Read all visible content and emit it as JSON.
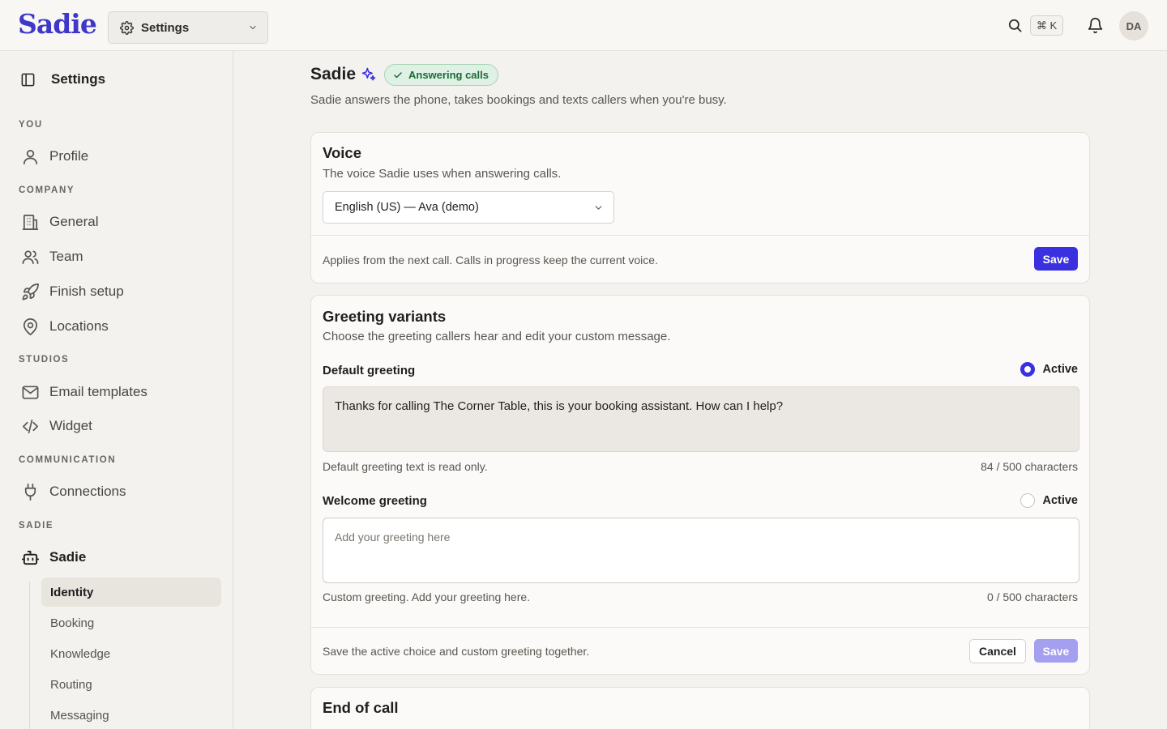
{
  "brand": {
    "logo": "Sadie",
    "accent": "#3b30e0"
  },
  "topbar": {
    "workspace_select": "Settings",
    "shortcut": "⌘ K",
    "avatar_initials": "DA"
  },
  "sidebar": {
    "title": "Settings",
    "sections": {
      "you": "YOU",
      "company": "COMPANY",
      "studios": "STUDIOS",
      "communication": "COMMUNICATION",
      "sadie": "SADIE"
    },
    "items": {
      "profile": "Profile",
      "general": "General",
      "team": "Team",
      "finish_setup": "Finish setup",
      "locations": "Locations",
      "email_templates": "Email templates",
      "widget": "Widget",
      "connections": "Connections",
      "sadie": "Sadie"
    },
    "sub_items": {
      "identity": "Identity",
      "booking": "Booking",
      "knowledge": "Knowledge",
      "routing": "Routing",
      "messaging": "Messaging"
    }
  },
  "page": {
    "title": "Sadie",
    "status_badge": "Answering calls",
    "subtitle": "Sadie answers the phone, takes bookings and texts callers when you're busy."
  },
  "voice": {
    "title": "Voice",
    "description": "The voice Sadie uses when answering calls.",
    "selected": "English (US) — Ava (demo)",
    "footer_note": "Applies from the next call. Calls in progress keep the current voice.",
    "save_label": "Save"
  },
  "greetings": {
    "title": "Greeting variants",
    "description": "Choose the greeting callers hear and edit your custom message.",
    "default": {
      "label": "Default greeting",
      "active_label": "Active",
      "active": true,
      "text": "Thanks for calling The Corner Table, this is your booking assistant. How can I help?",
      "helper": "Default greeting text is read only.",
      "count": "84 / 500 characters"
    },
    "welcome": {
      "label": "Welcome greeting",
      "active_label": "Active",
      "active": false,
      "placeholder": "Add your greeting here",
      "helper": "Custom greeting. Add your greeting here.",
      "count": "0 / 500 characters"
    },
    "footer_note": "Save the active choice and custom greeting together.",
    "cancel_label": "Cancel",
    "save_label": "Save"
  },
  "end_of_call": {
    "title": "End of call"
  }
}
